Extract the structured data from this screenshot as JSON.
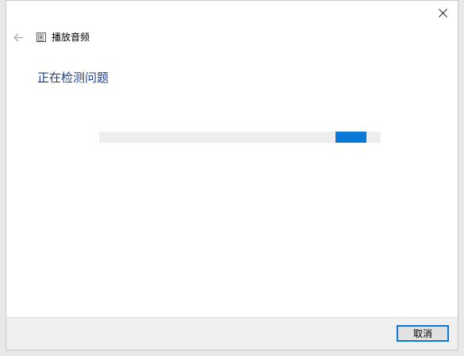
{
  "window": {
    "title": "播放音频"
  },
  "main": {
    "heading": "正在检测问题",
    "progress": {
      "indeterminate": true
    }
  },
  "footer": {
    "cancel_label": "取消"
  },
  "icons": {
    "close": "close-icon",
    "back": "back-arrow-icon",
    "app": "troubleshooter-icon"
  },
  "colors": {
    "accent": "#0a78d7",
    "heading": "#1b3f8f"
  }
}
